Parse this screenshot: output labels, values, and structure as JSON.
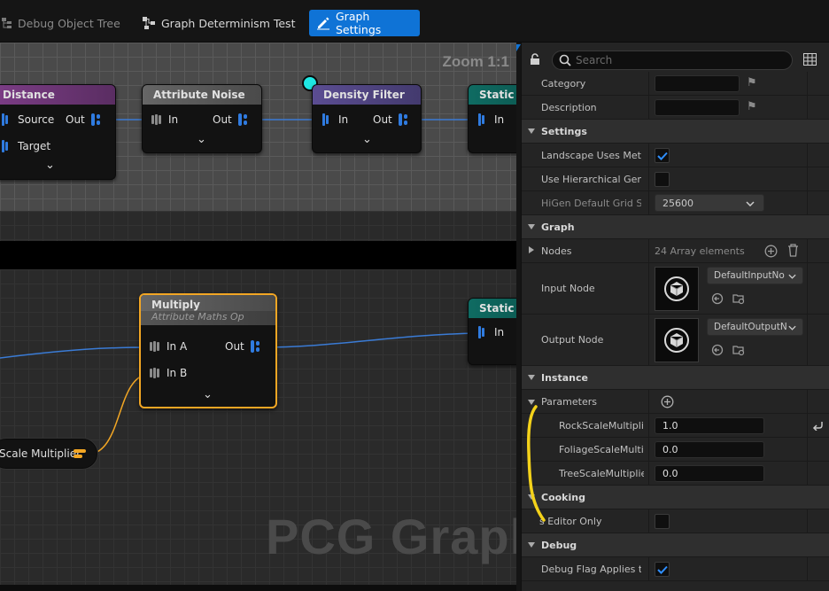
{
  "tabs": [
    {
      "label": "Debug Object Tree",
      "icon": "tree-icon",
      "active": false
    },
    {
      "label": "Graph Determinism Test",
      "icon": "graph-nodes-icon",
      "active": false
    },
    {
      "label": "Graph Settings",
      "icon": "pencil-icon",
      "active": true
    }
  ],
  "graph": {
    "zoom_label": "Zoom 1:1",
    "watermark": "PCG Graph",
    "nodes": {
      "distance": {
        "title": "Distance",
        "pins_in": [
          "Source",
          "Target"
        ],
        "pin_out": "Out",
        "color": "#7c3d86"
      },
      "attribute_noise": {
        "title": "Attribute Noise",
        "pin_in": "In",
        "pin_out": "Out",
        "color": "#5a5a5a"
      },
      "density_filter": {
        "title": "Density Filter",
        "pin_in": "In",
        "pin_out": "Out",
        "color": "#5b4d92"
      },
      "static_top": {
        "title": "Static M",
        "pin_in": "In",
        "color": "#0f6b62"
      },
      "multiply": {
        "title": "Multiply",
        "subtitle": "Attribute Maths Op",
        "pins_in": [
          "In A",
          "In B"
        ],
        "pin_out": "Out",
        "color": "#5a5a5a"
      },
      "static_bottom": {
        "title": "Static M",
        "pin_in": "In",
        "color": "#0f6b62"
      },
      "scale_multiplier": {
        "label": "Scale Multiplier"
      }
    },
    "expand_glyph": "⌄"
  },
  "panel": {
    "search_placeholder": "Search",
    "rows": {
      "category": {
        "label": "Category"
      },
      "description": {
        "label": "Description"
      },
      "settings_header": "Settings",
      "landscape": {
        "label": "Landscape Uses Met…",
        "checked": true
      },
      "hierarchical": {
        "label": "Use Hierarchical Gen…",
        "checked": false
      },
      "higen": {
        "label": "HiGen Default Grid Si…",
        "value": "25600"
      },
      "graph_header": "Graph",
      "nodes": {
        "label": "Nodes",
        "value": "24 Array elements"
      },
      "input_node": {
        "label": "Input Node",
        "value": "DefaultInputNo"
      },
      "output_node": {
        "label": "Output Node",
        "value": "DefaultOutputN"
      },
      "instance_header": "Instance",
      "parameters": {
        "label": "Parameters"
      },
      "rock": {
        "label": "RockScaleMultiplier",
        "value": "1.0"
      },
      "foliage": {
        "label": "FoliageScaleMultif",
        "value": "0.0"
      },
      "tree": {
        "label": "TreeScaleMultiplier",
        "value": "0.0"
      },
      "cooking_header": "Cooking",
      "editor_only": {
        "label": "s Editor Only",
        "checked": false
      },
      "debug_header": "Debug",
      "debug_flag": {
        "label": "Debug Flag Applies t…",
        "checked": true
      }
    }
  },
  "colors": {
    "accent": "#0f73d6",
    "selected_outline": "#f2a624",
    "annotation": "#f4d21a",
    "wire": "#3a7bd5",
    "pin_blue": "#2f7be0"
  }
}
